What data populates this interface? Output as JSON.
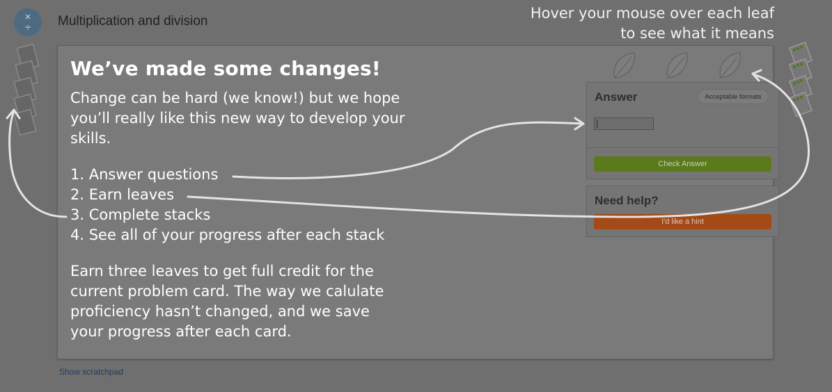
{
  "header": {
    "exercise_icon": "multiply-divide-icon",
    "title": "Multiplication and division"
  },
  "hover_hint": {
    "line1": "Hover your mouse over each leaf",
    "line2": "to see what it means"
  },
  "announcement": {
    "heading": "We’ve made some changes!",
    "intro": "Change can be hard (we know!) but we hope you’ll really like this new way to develop your skills.",
    "steps": [
      "1. Answer questions",
      "2. Earn leaves",
      "3. Complete stacks",
      "4. See all of your progress after each stack"
    ],
    "closing": "Earn three leaves to get full credit for the current problem card. The way we calulate proficiency hasn’t changed, and we save your progress after each card."
  },
  "leaves": {
    "icon": "leaf-icon",
    "count": 3,
    "earned": 0
  },
  "answer_panel": {
    "title": "Answer",
    "formats_label": "Acceptable formats",
    "input_value": "",
    "check_label": "Check Answer"
  },
  "help_panel": {
    "title": "Need help?",
    "hint_label": "I'd like a hint"
  },
  "scratchpad": {
    "label": "Show scratchpad"
  },
  "stacks": {
    "left_icon": "card-stack-icon",
    "right_icon": "completed-card-stack-icon"
  },
  "colors": {
    "overlay": "#6f6f6f",
    "check_button": "#5a7a1b",
    "hint_button": "#a44a16",
    "icon_blue": "#4d6a80",
    "card_leaf_green": "#4d7a1a"
  }
}
